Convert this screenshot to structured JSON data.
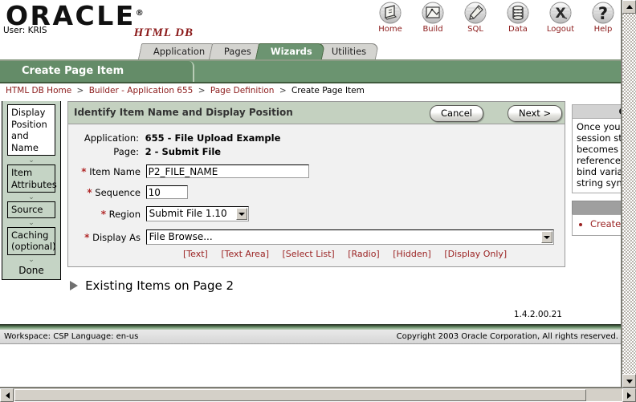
{
  "brand": {
    "company": "ORACLE",
    "registered": "®",
    "product": "HTML DB"
  },
  "user_line": "User: KRIS",
  "iconbar": [
    {
      "label": "Home",
      "icon": "home-icon"
    },
    {
      "label": "Build",
      "icon": "build-icon"
    },
    {
      "label": "SQL",
      "icon": "sql-icon"
    },
    {
      "label": "Data",
      "icon": "data-icon"
    },
    {
      "label": "Logout",
      "icon": "logout-icon"
    },
    {
      "label": "Help",
      "icon": "help-icon"
    }
  ],
  "tabs": [
    {
      "label": "Application",
      "selected": false
    },
    {
      "label": "Pages",
      "selected": false
    },
    {
      "label": "Wizards",
      "selected": true
    },
    {
      "label": "Utilities",
      "selected": false
    }
  ],
  "page_title": "Create Page Item",
  "breadcrumb": [
    {
      "label": "HTML DB Home",
      "current": false
    },
    {
      "label": "Builder - Application 655",
      "current": false
    },
    {
      "label": "Page Definition",
      "current": false
    },
    {
      "label": "Create Page Item",
      "current": true
    }
  ],
  "breadcrumb_separator": ">",
  "wizard": {
    "steps": [
      {
        "label": "Display Position and Name",
        "current": true
      },
      {
        "label": "Item Attributes",
        "current": false
      },
      {
        "label": "Source",
        "current": false
      },
      {
        "label": "Caching (optional)",
        "current": false
      }
    ],
    "arrow_glyph": "⌄",
    "done_label": "Done"
  },
  "region": {
    "header_title": "Identify Item Name and Display Position",
    "cancel_label": "Cancel",
    "next_label": "Next >",
    "info": [
      {
        "label": "Application:",
        "value": "655 - File Upload Example"
      },
      {
        "label": "Page:",
        "value": "2 - Submit File"
      }
    ],
    "fields": {
      "item_name": {
        "label": "Item Name",
        "value": "P2_FILE_NAME",
        "required": true
      },
      "sequence": {
        "label": "Sequence",
        "value": "10",
        "required": true
      },
      "region": {
        "label": "Region",
        "value": "Submit File 1.10",
        "required": true
      },
      "display_as": {
        "label": "Display As",
        "value": "File Browse...",
        "required": true
      }
    },
    "type_links": [
      "[Text]",
      "[Text Area]",
      "[Select List]",
      "[Radio]",
      "[Hidden]",
      "[Display Only]"
    ],
    "existing_items_label": "Existing Items on Page 2",
    "version": "1.4.2.00.21"
  },
  "help": {
    "boxes": [
      {
        "title": "Create Page Item",
        "body": "Once you create an item its session state value becomes available for reference using standard bind variable or substitution string syntax.",
        "kind": "text"
      },
      {
        "title": "",
        "items": [
          "Create Page Item"
        ],
        "kind": "list"
      }
    ]
  },
  "footer": {
    "left": "Workspace: CSP   Language: en-us",
    "right": "Copyright 2003 Oracle Corporation, All rights reserved."
  },
  "colors": {
    "title_green": "#6b9470",
    "tab_selected_green": "#6c9471",
    "region_header_sage": "#c4d1c0",
    "sidebar_sage": "#c5d4c5",
    "link_red": "#8b1a1a",
    "required_red": "#b12a2a"
  }
}
